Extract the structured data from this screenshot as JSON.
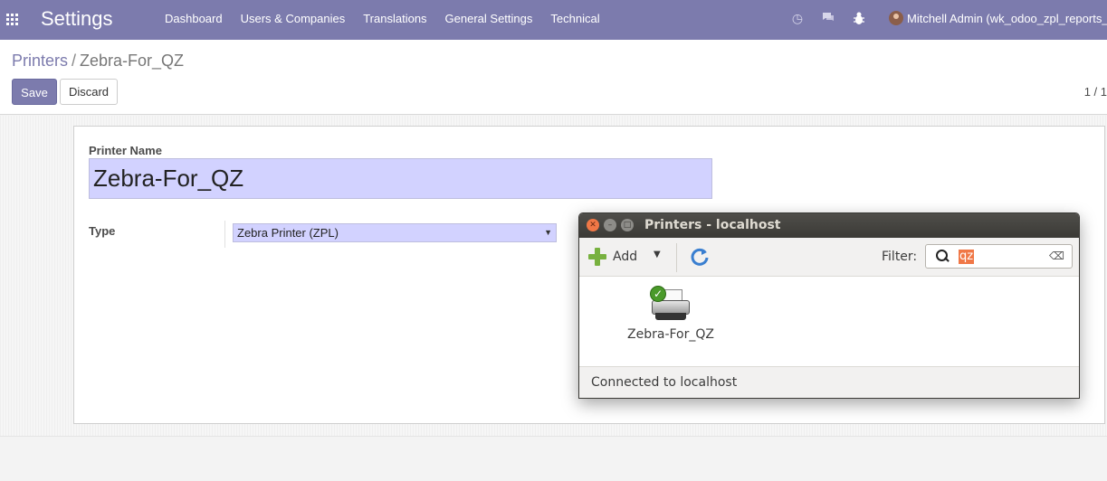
{
  "navbar": {
    "brand": "Settings",
    "menu": [
      "Dashboard",
      "Users & Companies",
      "Translations",
      "General Settings",
      "Technical"
    ],
    "user_name": "Mitchell Admin (wk_odoo_zpl_reports_"
  },
  "control_panel": {
    "breadcrumb_parent": "Printers",
    "breadcrumb_separator": "/",
    "breadcrumb_current": "Zebra-For_QZ",
    "save_label": "Save",
    "discard_label": "Discard",
    "pager": "1 / 1"
  },
  "form": {
    "printer_name_label": "Printer Name",
    "printer_name_value": "Zebra-For_QZ",
    "type_label": "Type",
    "type_value": "Zebra Printer (ZPL)"
  },
  "printers_window": {
    "title": "Printers - localhost",
    "add_label": "Add",
    "filter_label": "Filter:",
    "filter_value": "qz",
    "printers": [
      {
        "name": "Zebra-For_QZ",
        "status": "default"
      }
    ],
    "status_text": "Connected to localhost"
  },
  "colors": {
    "navbar": "#7c7bad",
    "field_required": "#d2d2ff",
    "window_titlebar": "#3b3a36",
    "close_button": "#f07746"
  }
}
